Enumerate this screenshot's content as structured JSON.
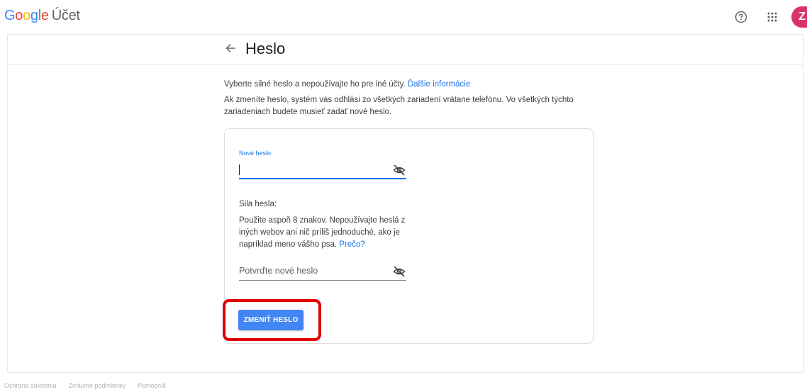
{
  "header": {
    "logo": {
      "letters": [
        "G",
        "o",
        "o",
        "g",
        "l",
        "e"
      ],
      "product": "Účet"
    },
    "avatar_letter": "Z"
  },
  "page": {
    "title": "Heslo",
    "intro": {
      "line1": "Vyberte silné heslo a nepoužívajte ho pre iné účty.",
      "learn_more": "Ďalšie informácie",
      "line2": "Ak zmeníte heslo, systém vás odhlási zo všetkých zariadení vrátane telefónu. Vo všetkých týchto zariadeniach budete musieť zadať nové heslo."
    }
  },
  "form": {
    "new_password": {
      "label": "Nové heslo",
      "value": ""
    },
    "strength": {
      "heading": "Sila hesla:",
      "hint": "Použite aspoň 8 znakov. Nepoužívajte heslá z iných webov ani nič príliš jednoduché, ako je napríklad meno vášho psa.",
      "why_link": "Prečo?"
    },
    "confirm_password": {
      "placeholder": "Potvrďte nové heslo",
      "value": ""
    },
    "submit_label": "ZMENIŤ HESLO"
  },
  "footer": {
    "links": [
      "Ochrana súkromia",
      "Zmluvné podmienky",
      "Pomocník"
    ],
    "separator": "·"
  },
  "colors": {
    "accent": "#1a73e8",
    "button": "#4285f4",
    "highlight": "#e00000",
    "avatar": "#d6336c"
  }
}
